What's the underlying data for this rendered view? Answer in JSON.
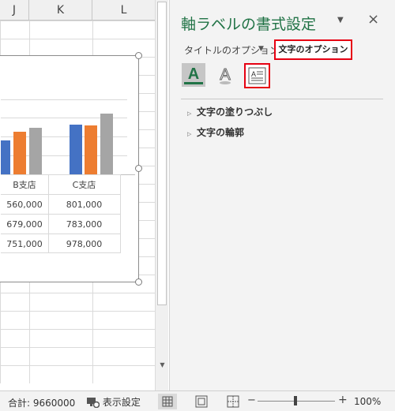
{
  "sheet": {
    "columns": [
      "J",
      "K",
      "L"
    ],
    "table": {
      "headers": [
        "B支店",
        "C支店"
      ],
      "rows": [
        [
          "560,000",
          "801,000"
        ],
        [
          "679,000",
          "783,000"
        ],
        [
          "751,000",
          "978,000"
        ]
      ]
    },
    "series_colors": [
      "#4472c4",
      "#ed7d31",
      "#a5a5a5"
    ]
  },
  "pane": {
    "title": "軸ラベルの書式設定",
    "dropdown_icon": "chevron-down-icon",
    "close_label": "×",
    "tab_title_options": "タイトルのオプション",
    "tab_text_options": "文字のオプション",
    "icons": [
      "text-fill-outline-icon",
      "text-effects-icon",
      "textbox-icon"
    ],
    "sections": [
      {
        "label": "文字の塗りつぶし"
      },
      {
        "label": "文字の輪郭"
      }
    ]
  },
  "status": {
    "sum": "合計: 9660000",
    "display_settings": "表示設定",
    "zoom_minus": "−",
    "zoom_plus": "+",
    "zoom": "100%",
    "zoom_fraction": 0.5
  }
}
